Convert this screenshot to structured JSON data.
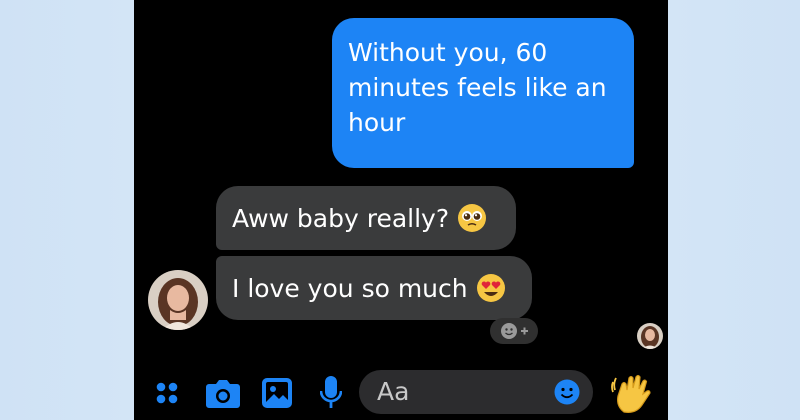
{
  "conversation": {
    "messages": [
      {
        "direction": "sent",
        "text": "Without you, 60 minutes feels like an hour"
      },
      {
        "direction": "received",
        "text": "Aww baby really?",
        "emoji": "pleading-face"
      },
      {
        "direction": "received",
        "text": "I love you so much",
        "emoji": "heart-eyes-face"
      }
    ]
  },
  "composer": {
    "placeholder": "Aa",
    "icons": [
      "apps-icon",
      "camera-icon",
      "gallery-icon",
      "microphone-icon",
      "emoji-icon",
      "waving-hand-icon"
    ]
  },
  "colors": {
    "sent_bubble": "#1d84f5",
    "received_bubble": "#3a3b3c",
    "accent": "#1d84f5",
    "background": "#000000"
  }
}
